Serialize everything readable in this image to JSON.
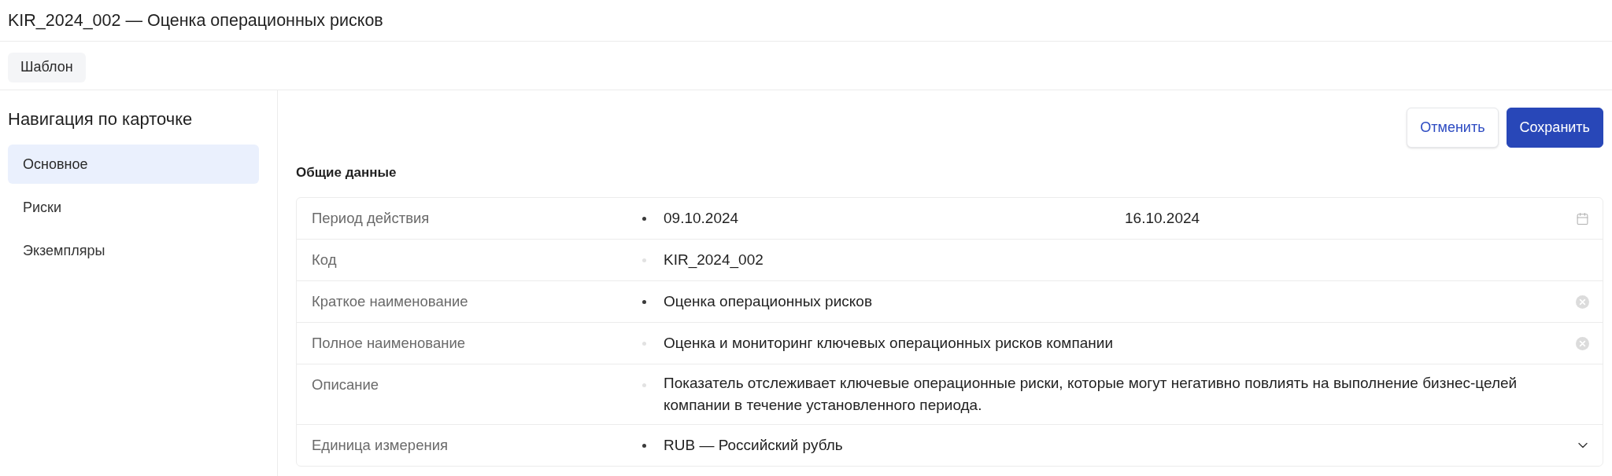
{
  "header": {
    "title": "KIR_2024_002 — Оценка операционных рисков"
  },
  "toolbar": {
    "buttons": [
      "Шаблон"
    ]
  },
  "sidebar": {
    "title": "Навигация по карточке",
    "items": [
      {
        "label": "Основное",
        "selected": true
      },
      {
        "label": "Риски",
        "selected": false
      },
      {
        "label": "Экземпляры",
        "selected": false
      }
    ]
  },
  "actions": [
    {
      "label": "Отменить",
      "kind": "secondary"
    },
    {
      "label": "Сохранить",
      "kind": "primary"
    }
  ],
  "section": {
    "title": "Общие данные",
    "fields": [
      {
        "kind": "date_range",
        "label": "Период действия",
        "required": true,
        "start": "09.10.2024",
        "end": "16.10.2024"
      },
      {
        "kind": "text",
        "label": "Код",
        "required": false,
        "value": "KIR_2024_002",
        "clearable": false
      },
      {
        "kind": "text",
        "label": "Краткое наименование",
        "required": true,
        "value": "Оценка операционных рисков",
        "clearable": true
      },
      {
        "kind": "text",
        "label": "Полное наименование",
        "required": false,
        "value": "Оценка и мониторинг ключевых операционных рисков компании",
        "clearable": true
      },
      {
        "kind": "textarea",
        "label": "Описание",
        "required": false,
        "value": "Показатель отслеживает ключевые операционные риски, которые могут негативно повлиять на выполнение бизнес-целей компании в течение установленного периода."
      },
      {
        "kind": "select",
        "label": "Единица измерения",
        "required": true,
        "value": "RUB — Российский рубль"
      }
    ]
  }
}
